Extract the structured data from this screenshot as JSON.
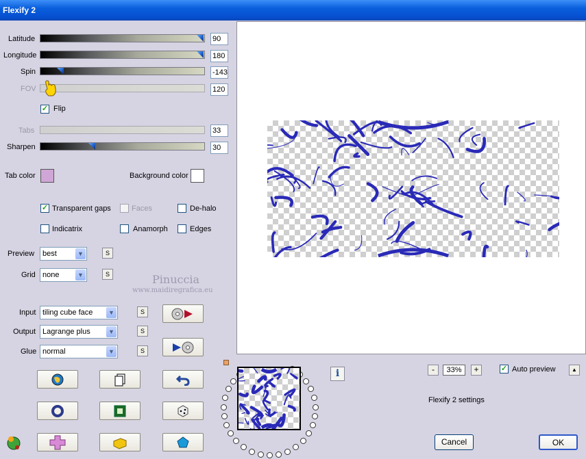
{
  "window": {
    "title": "Flexify 2"
  },
  "sliders": {
    "latitude": {
      "label": "Latitude",
      "value": "90",
      "level": 1.0
    },
    "longitude": {
      "label": "Longitude",
      "value": "180",
      "level": 1.0
    },
    "spin": {
      "label": "Spin",
      "value": "-143",
      "level": 0.1
    },
    "fov": {
      "label": "FOV",
      "value": "120"
    },
    "tabs": {
      "label": "Tabs",
      "value": "33"
    },
    "sharpen": {
      "label": "Sharpen",
      "value": "30",
      "level": 0.3
    }
  },
  "flip": {
    "label": "Flip",
    "checked": true
  },
  "colors": {
    "tab_label": "Tab color",
    "tab_color": "#cfa6d6",
    "bg_label": "Background color",
    "bg_color": "#ffffff"
  },
  "options": {
    "transparent_gaps": {
      "label": "Transparent gaps",
      "checked": true
    },
    "faces": {
      "label": "Faces",
      "checked": false
    },
    "dehalo": {
      "label": "De-halo",
      "checked": false
    },
    "indicatrix": {
      "label": "Indicatrix",
      "checked": false
    },
    "anamorph": {
      "label": "Anamorph",
      "checked": false
    },
    "edges": {
      "label": "Edges",
      "checked": false
    }
  },
  "preview_select": {
    "label": "Preview",
    "value": "best"
  },
  "grid_select": {
    "label": "Grid",
    "value": "none"
  },
  "watermark": {
    "name": "Pinuccia",
    "url": "www.maidiregrafica.eu"
  },
  "input_select": {
    "label": "Input",
    "value": "tiling cube face"
  },
  "output_select": {
    "label": "Output",
    "value": "Lagrange plus"
  },
  "glue_select": {
    "label": "Glue",
    "value": "normal"
  },
  "s_label": "S",
  "zoom": {
    "minus": "-",
    "value": "33%",
    "plus": "+"
  },
  "auto_preview": {
    "label": "Auto preview",
    "checked": true
  },
  "up_arrow": "▲",
  "settings_text": "Flexify 2 settings",
  "info_glyph": "i",
  "buttons": {
    "cancel": "Cancel",
    "ok": "OK"
  },
  "accent": "#0550d2",
  "art_color": "#2a2ab8"
}
